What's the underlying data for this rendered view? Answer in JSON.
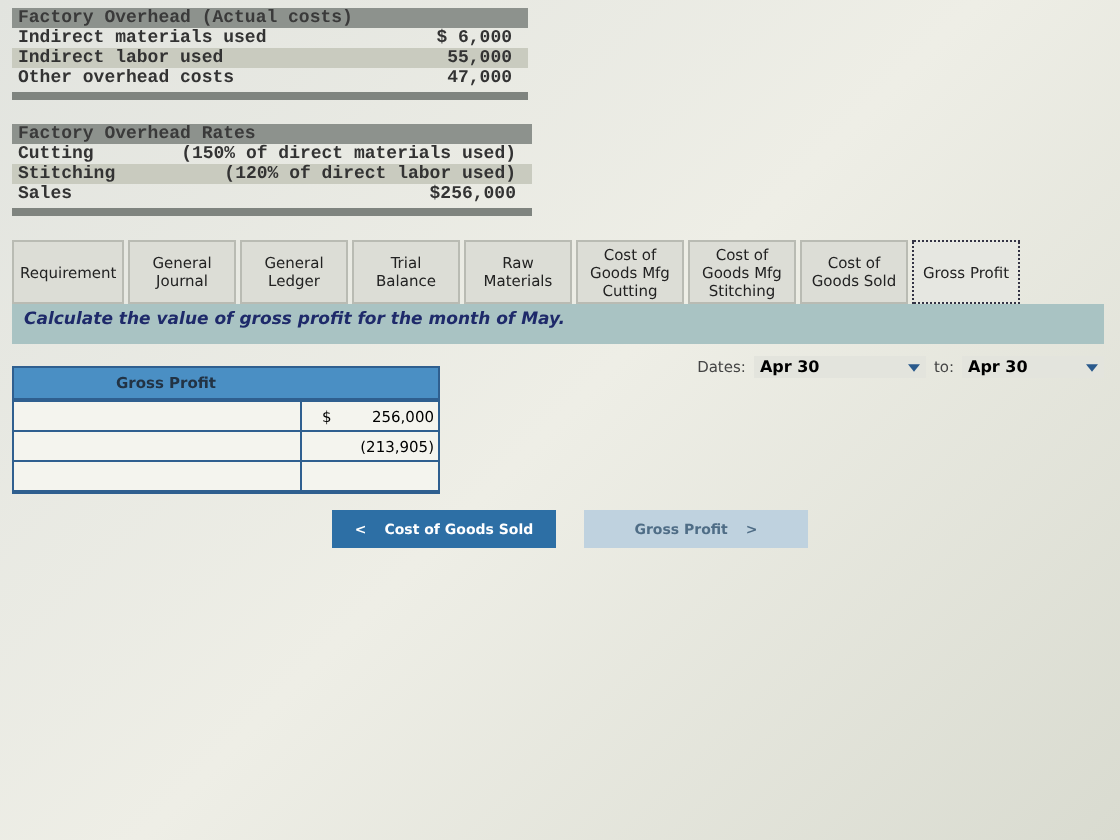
{
  "overhead_actual": {
    "title": "Factory Overhead (Actual costs)",
    "rows": [
      {
        "label": "Indirect materials used",
        "amount": "$ 6,000"
      },
      {
        "label": "Indirect labor used",
        "amount": "55,000"
      },
      {
        "label": "Other overhead costs",
        "amount": "47,000"
      }
    ]
  },
  "overhead_rates": {
    "title": "Factory Overhead Rates",
    "rows": [
      {
        "label": "Cutting",
        "amount": "(150% of direct materials used)"
      },
      {
        "label": "Stitching",
        "amount": "(120% of direct labor used)"
      },
      {
        "label": "Sales",
        "amount": "$256,000"
      }
    ]
  },
  "tabs": [
    {
      "label": "Requirement",
      "selected": false
    },
    {
      "label": "General Journal",
      "selected": false
    },
    {
      "label": "General Ledger",
      "selected": false
    },
    {
      "label": "Trial Balance",
      "selected": false
    },
    {
      "label": "Raw Materials",
      "selected": false
    },
    {
      "label": "Cost of Goods Mfg Cutting",
      "selected": false
    },
    {
      "label": "Cost of Goods Mfg Stitching",
      "selected": false
    },
    {
      "label": "Cost of Goods Sold",
      "selected": false
    },
    {
      "label": "Gross Profit",
      "selected": true
    }
  ],
  "instruction": "Calculate the value of gross profit for the month of May.",
  "dates": {
    "label": "Dates:",
    "from": "Apr 30",
    "to_label": "to:",
    "to": "Apr 30"
  },
  "table": {
    "title": "Gross Profit",
    "rows": [
      {
        "currency": "$",
        "amount": "256,000"
      },
      {
        "amount": "(213,905)"
      },
      {}
    ]
  },
  "buttons": [
    {
      "kind": "prev",
      "arrow": "<",
      "label": "Cost of Goods Sold",
      "disabled": false
    },
    {
      "kind": "next",
      "arrow": ">",
      "label": "Gross Profit",
      "disabled": true
    }
  ]
}
